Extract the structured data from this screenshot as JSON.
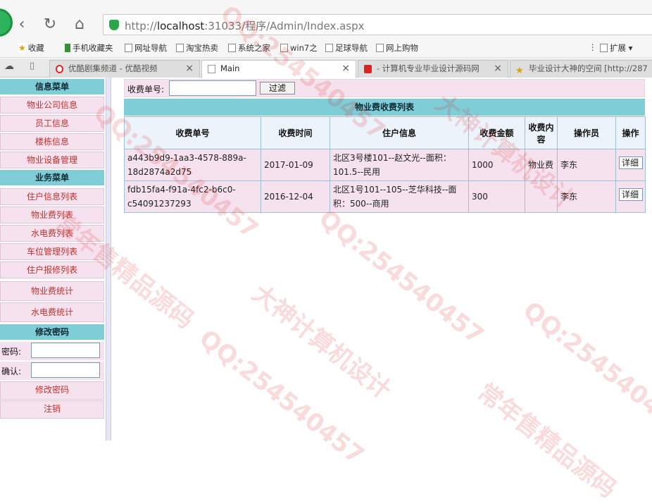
{
  "browser": {
    "url_prefix": "http://",
    "url_host": "localhost",
    "url_rest": ":31033/程序/Admin/Index.aspx",
    "bookmarks": [
      "收藏",
      "手机收藏夹",
      "网址导航",
      "淘宝热卖",
      "系统之家",
      "win7之",
      "足球导航",
      "网上购物"
    ],
    "ext_label": "扩展",
    "tabs": [
      {
        "label": "优酷剧集频道 - 优酷视频",
        "active": false
      },
      {
        "label": "Main",
        "active": true
      },
      {
        "label": "- 计算机专业毕业设计源码网",
        "active": false
      },
      {
        "label": "毕业设计大神的空间 [http://287",
        "active": false
      }
    ]
  },
  "sidebar": {
    "sections": [
      {
        "header": "信息菜单",
        "items": [
          "物业公司信息",
          "员工信息",
          "楼栋信息",
          "物业设备管理"
        ]
      },
      {
        "header": "业务菜单",
        "items": [
          "住户信息列表",
          "物业费列表",
          "水电费列表",
          "车位管理列表",
          "住户报修列表",
          "物业费统计",
          "水电费统计"
        ]
      },
      {
        "header": "修改密码",
        "password_label": "密码:",
        "confirm_label": "确认:",
        "items": [
          "修改密码",
          "注销"
        ]
      }
    ]
  },
  "filter": {
    "label": "收费单号:",
    "value": "",
    "button": "过滤"
  },
  "table": {
    "title": "物业费收费列表",
    "columns": [
      "收费单号",
      "收费时间",
      "住户信息",
      "收费金额",
      "收费内容",
      "操作员",
      "操作"
    ],
    "rows": [
      {
        "id": "a443b9d9-1aa3-4578-889a-18d2874a2d75",
        "time": "2017-01-09",
        "resident": "北区3号楼101--赵文光--面积：101.5--民用",
        "amount": "1000",
        "content": "物业费",
        "operator": "李东",
        "action": "详细"
      },
      {
        "id": "fdb15fa4-f91a-4fc2-b6c0-c54091237293",
        "time": "2016-12-04",
        "resident": "北区1号101--105--芝华科技--面积：500--商用",
        "amount": "300",
        "content": "",
        "operator": "李东",
        "action": "详细"
      }
    ]
  },
  "watermark": [
    "QQ:254540457",
    "大神计算机设计",
    "常年售精品源码"
  ]
}
